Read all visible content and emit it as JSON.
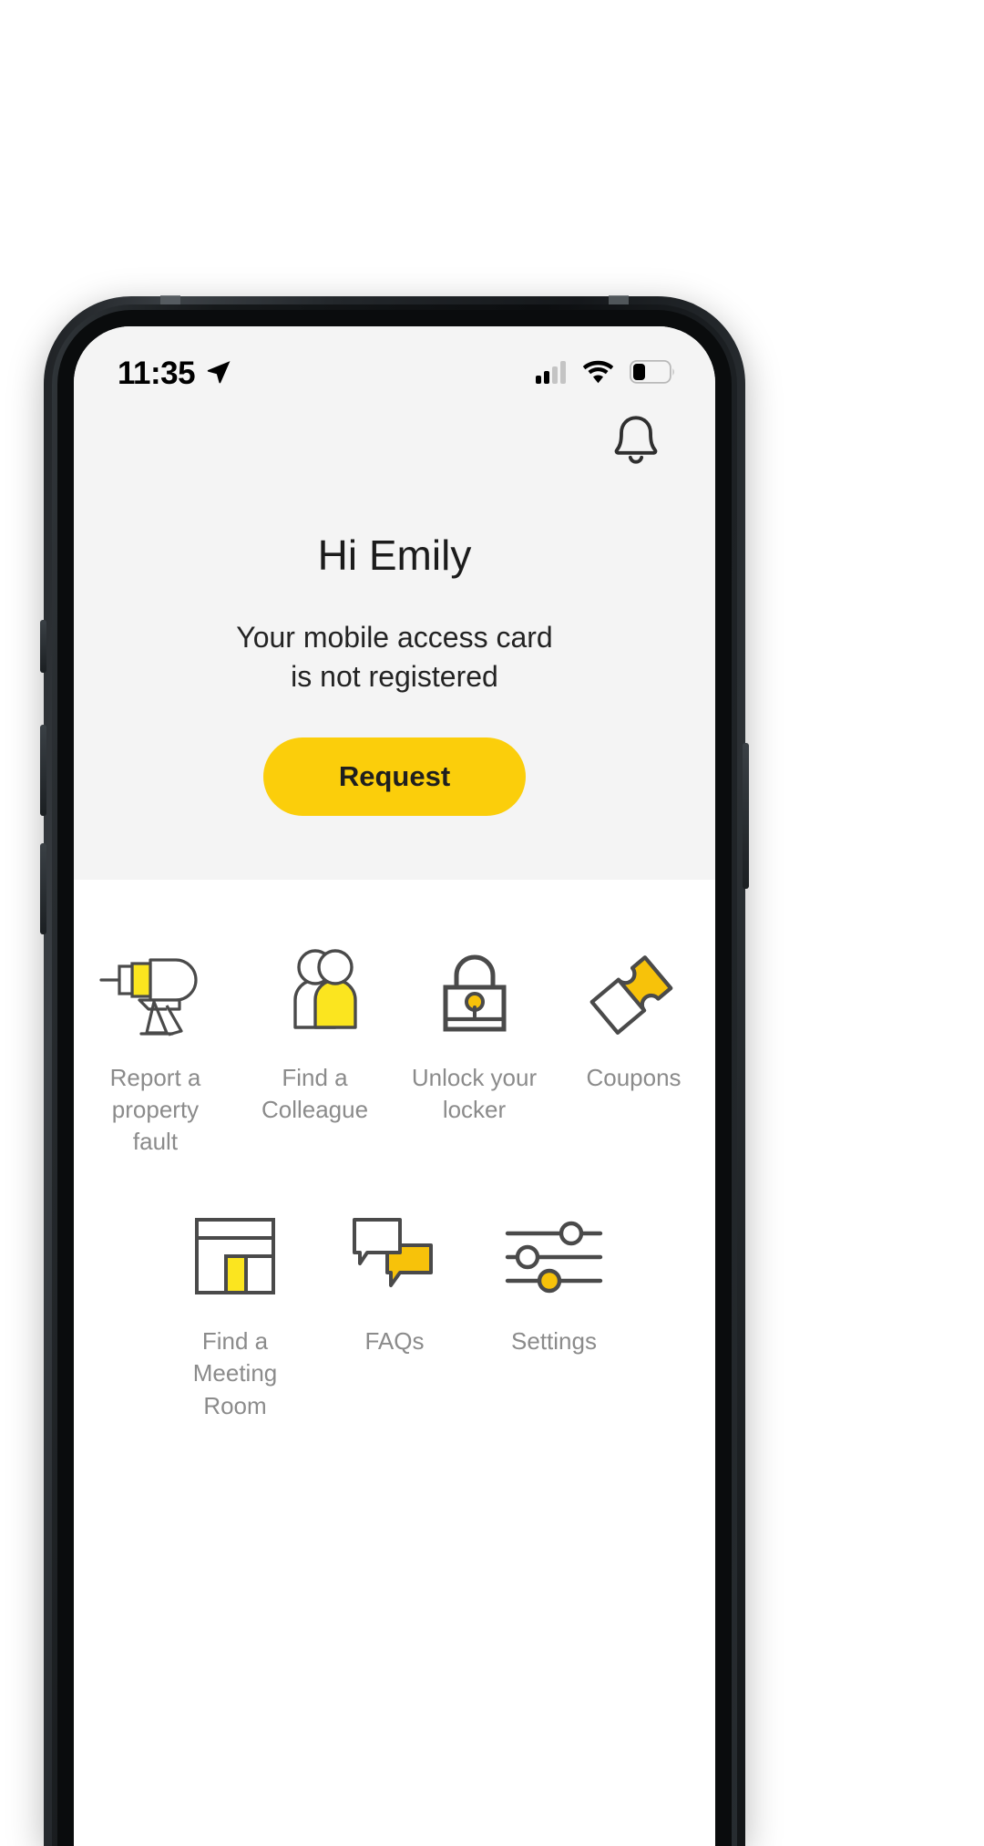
{
  "status_bar": {
    "time": "11:35",
    "location_icon": "location-arrow-icon",
    "signal_icon": "cellular-signal-icon",
    "signal_bars_filled": 2,
    "signal_bars_total": 4,
    "wifi_icon": "wifi-icon",
    "battery_icon": "battery-icon",
    "battery_level_percent": 32
  },
  "header": {
    "notification_icon": "bell-icon",
    "greeting": "Hi Emily",
    "status_line_1": "Your mobile access card",
    "status_line_2": "is not registered",
    "cta_label": "Request"
  },
  "shortcuts": {
    "row1": [
      {
        "icon": "drill-icon",
        "label_line_1": "Report a",
        "label_line_2": "property",
        "label_line_3": "fault"
      },
      {
        "icon": "people-icon",
        "label_line_1": "Find a",
        "label_line_2": "Colleague",
        "label_line_3": ""
      },
      {
        "icon": "padlock-icon",
        "label_line_1": "Unlock your",
        "label_line_2": "locker",
        "label_line_3": ""
      },
      {
        "icon": "ticket-icon",
        "label_line_1": "Coupons",
        "label_line_2": "",
        "label_line_3": ""
      }
    ],
    "row2": [
      {
        "icon": "meeting-room-icon",
        "label_line_1": "Find a",
        "label_line_2": "Meeting",
        "label_line_3": "Room"
      },
      {
        "icon": "chat-bubbles-icon",
        "label_line_1": "FAQs",
        "label_line_2": "",
        "label_line_3": ""
      },
      {
        "icon": "sliders-icon",
        "label_line_1": "Settings",
        "label_line_2": "",
        "label_line_3": ""
      }
    ]
  },
  "theme": {
    "accent_yellow": "#FBCE0B",
    "accent_yellow_deep": "#F7C20A",
    "icon_stroke": "#4a4a4a",
    "header_bg": "#f4f4f4",
    "body_bg": "#ffffff",
    "label_gray": "#8b8b8b"
  }
}
